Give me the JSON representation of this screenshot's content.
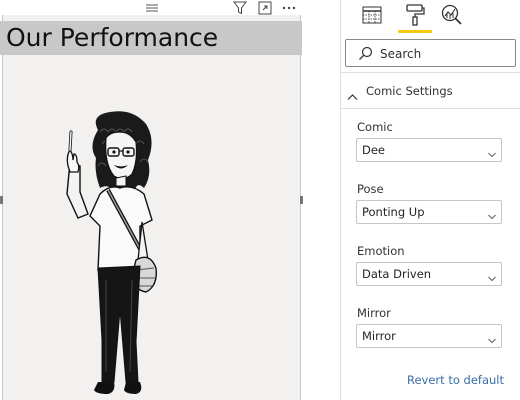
{
  "visual": {
    "title": "Our Performance",
    "header_icons": [
      "drag-handle-icon",
      "filter-icon",
      "focus-mode-icon",
      "more-options-icon"
    ]
  },
  "pane": {
    "tabs": [
      {
        "name": "fields-tab",
        "icon": "table-grid-icon"
      },
      {
        "name": "format-tab",
        "icon": "paint-roller-icon",
        "active": true
      },
      {
        "name": "analytics-tab",
        "icon": "magnifier-chart-icon"
      }
    ],
    "accent_color": "#f2c811",
    "search": {
      "placeholder": "Search"
    },
    "section": {
      "title": "Comic Settings",
      "expanded": true
    },
    "fields": {
      "comic": {
        "label": "Comic",
        "value": "Dee"
      },
      "pose": {
        "label": "Pose",
        "value": "Ponting Up"
      },
      "emotion": {
        "label": "Emotion",
        "value": "Data Driven"
      },
      "mirror": {
        "label": "Mirror",
        "value": "Mirror"
      }
    },
    "revert_label": "Revert to default",
    "link_color": "#3a6ea5"
  }
}
